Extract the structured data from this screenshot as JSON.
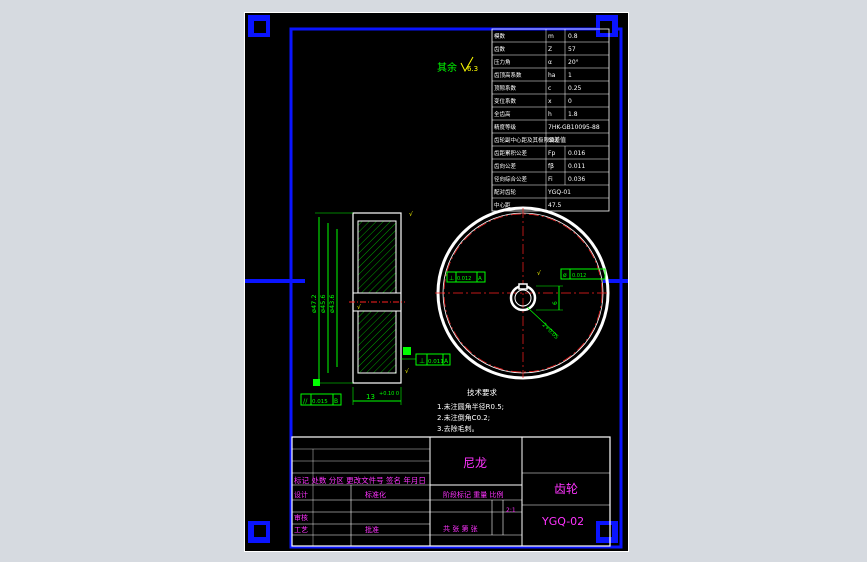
{
  "colors": {
    "frame": "#0a14ff",
    "line": "#ffffff",
    "dim": "#00ff00",
    "center": "#ff2020",
    "yellow": "#ffff00",
    "magenta": "#ff33ff",
    "hatch": "#00cc00"
  },
  "roughness_note": "其余",
  "roughness_value": "6.3",
  "gear_table": [
    [
      "模数",
      "m",
      "0.8"
    ],
    [
      "齿数",
      "Z",
      "57"
    ],
    [
      "压力角",
      "α",
      "20°"
    ],
    [
      "齿顶高系数",
      "ha",
      "1"
    ],
    [
      "顶隙系数",
      "c",
      "0.25"
    ],
    [
      "变位系数",
      "x",
      "0"
    ],
    [
      "全齿高",
      "h",
      "1.8"
    ],
    [
      "精度等级",
      "7HK-GB10095-88",
      ""
    ],
    [
      "齿轮副中心距及其极限偏差",
      "公差值",
      ""
    ],
    [
      "齿距累积公差",
      "Fp",
      "0.016"
    ],
    [
      "齿向公差",
      "fβ",
      "0.011"
    ],
    [
      "径向综合公差",
      "Fi",
      "0.036"
    ],
    [
      "配对齿轮",
      "YGQ-01",
      ""
    ],
    [
      "中心距",
      "47.5",
      ""
    ]
  ],
  "side_dims": [
    "ø47.2",
    "ø45.6",
    "ø43.6"
  ],
  "width_dim": "13",
  "width_tol": "+0.10\n0",
  "flatness": {
    "sym": "//",
    "val": "0.015",
    "datum": "B"
  },
  "perp": {
    "sym": "⊥",
    "val": "0.011",
    "datum": "A"
  },
  "circ_left": {
    "sym": "⊥",
    "val": "0.012",
    "datum": "A"
  },
  "circ_right": {
    "sym": "ø",
    "val": "0.012",
    "datum": ""
  },
  "key_dim": "2+0.05",
  "bore_dim": "6",
  "notes_title": "技术要求",
  "notes": [
    "1.未注圆角半径R0.5;",
    "2.未注倒角C0.2;",
    "3.去除毛刺。"
  ],
  "title_block": {
    "company": "尼龙",
    "part_name": "齿轮",
    "drawing_no": "YGQ-02",
    "header_row": "标记 处数 分区 更改文件号 签名 年月日",
    "design": "设计",
    "standard": "标准化",
    "stage": "阶段标记 重量 比例",
    "scale": "2:1",
    "check": "审核",
    "process": "工艺",
    "approve": "批准",
    "sheets": "共 张 第 张"
  }
}
